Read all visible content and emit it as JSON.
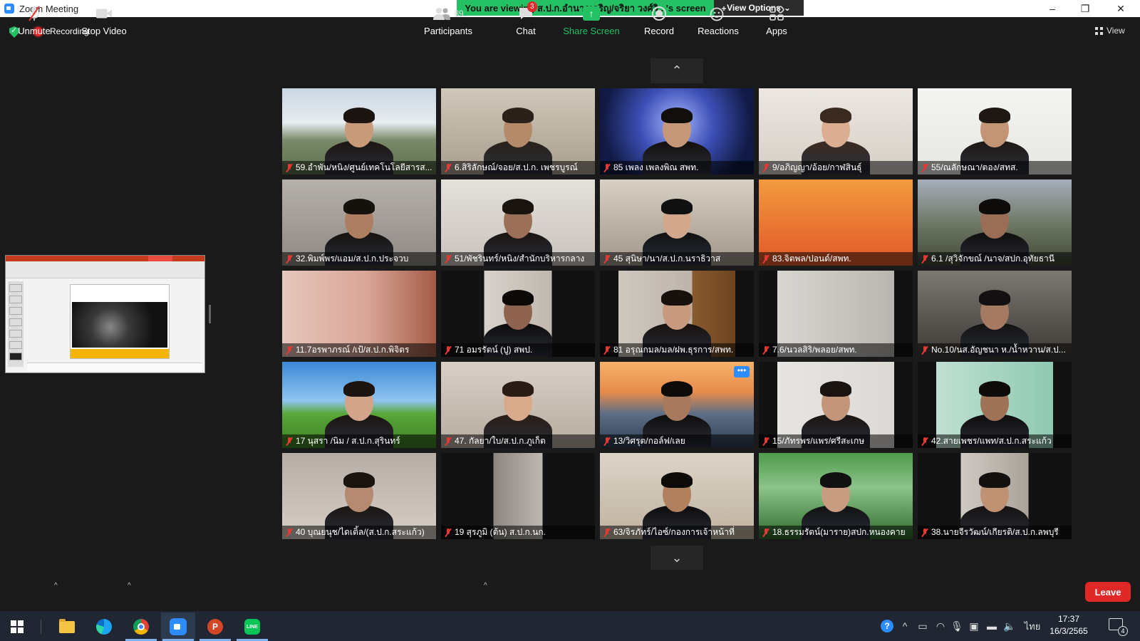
{
  "window": {
    "title": "Zoom Meeting",
    "share_banner": "You are viewing ส.ป.ก.อำนาจเจริญ/จริยา วงศ์วิ...'s screen",
    "view_options": "View Options",
    "minimize": "–",
    "maximize": "❐",
    "close": "✕"
  },
  "top": {
    "recording_label": "Recording",
    "view_label": "View"
  },
  "paging": {
    "up": "⌃",
    "down": "⌄"
  },
  "colors": {
    "accent_green": "#23c064",
    "record_red": "#e02828",
    "zoom_blue": "#2d8cff",
    "muted_red": "#e53935",
    "meeting_bg": "#1a1a1a",
    "taskbar_bg": "#202733"
  },
  "participants": [
    {
      "name": "59.อำพัน/หนิง/ศูนย์เทคโนโลยีสารส...",
      "bg": "linear-gradient(#c9d6e3 0%, #e6ecf0 40%, #7a8a6a 60%, #5b6f4a 100%)",
      "skin": "#c99a7a",
      "hair": "#1b1410"
    },
    {
      "name": "6.สิริลักษณ์/จอย/ส.ป.ก. เพชรบูรณ์",
      "bg": "linear-gradient(#cfc7b8, #a89f90)",
      "skin": "#b58a6a",
      "hair": "#2a211a"
    },
    {
      "name": "85 เพลง เพลงพิณ สพท.",
      "bg": "radial-gradient(circle at 50% 40%, #a7b7ff 0, #3c4fb5 40%, #111a44 80%)",
      "skin": "#c5987a",
      "hair": "#120e0c"
    },
    {
      "name": "9/อภิญญา/อ้อย/กาฬสินธุ์",
      "bg": "linear-gradient(#ece7e1, #d6cec6)",
      "skin": "#dbae92",
      "hair": "#3b2a20"
    },
    {
      "name": "55/ณลักษณา/ตอง/สทส.",
      "bg": "linear-gradient(#f4f4f2, #e6e6e2)",
      "skin": "#c49476",
      "hair": "#1e1712"
    },
    {
      "name": "32.พิมพ์พร/แอม/ส.ป.ก.ประจวบ",
      "bg": "linear-gradient(#b5b0aa, #8f8983)",
      "skin": "#ad7e62",
      "hair": "#15110d"
    },
    {
      "name": "51/พัชรินทร์/หนิง/สำนักบริหารกลาง",
      "bg": "linear-gradient(#e4e0da, #c9c3bc)",
      "skin": "#9c7058",
      "hair": "#1a1410"
    },
    {
      "name": "45 สุนิษา/นา/ส.ป.ก.นราธิวาส",
      "bg": "linear-gradient(#d8d0c4, #a0968a)",
      "skin": "#d2a88d",
      "hair": "#101010"
    },
    {
      "name": "83.จิตพล/ปอนด์/สพท.",
      "bg": "linear-gradient(#f29a3d, #e2572a)",
      "skin": "none",
      "hair": "none"
    },
    {
      "name": "6.1 /สุวิจักขณ์ /นาจ/สปก.อุทัยธานี",
      "bg": "linear-gradient(#a6aebb 0%, #6b7461 55%, #3f4636 100%)",
      "skin": "#9a6e56",
      "hair": "#0e0c0b"
    },
    {
      "name": "11.7อรพาภรณ์ /เป้/ส.ป.ก.พิจิตร",
      "bg": "linear-gradient(90deg, #e7c7bd 0%, #d9a596 55%, #a45b46 100%)",
      "skin": "none",
      "hair": "none"
    },
    {
      "name": "71 อมรรัตน์ (ปู) สพป.",
      "bg": "linear-gradient(90deg, #121212 0%, #121212 28%, #d7d2cb 28%, #bfb8ae 72%, #121212 72%)",
      "skin": "#8e6450",
      "hair": "#0c0a09"
    },
    {
      "name": "81 อรุณกมล/มล/ฝพ.ธุรการ/สพท.",
      "bg": "linear-gradient(90deg, #121212 0%, #121212 12%, #cfc8bf 12%, #bdb4aa 60%, #8a5a2f 60%, #6c441f 88%, #121212 88%)",
      "skin": "#c7997d",
      "hair": "#17110d"
    },
    {
      "name": "7.6/นวลสิริ/พลอย/สพท.",
      "bg": "linear-gradient(90deg, #121212 0%, #121212 12%, #d9d6d2 12%, #b9b5b0 88%, #121212 88%)",
      "skin": "none",
      "hair": "none"
    },
    {
      "name": "No.10/นส.อัญชนา ห./น้ำหวาน/ส.ป...",
      "bg": "linear-gradient(#7c7872, #3d3a36)",
      "skin": "#a47b62",
      "hair": "#121010"
    },
    {
      "name": "17 นุสรา /นิม / ส.ป.ก.สุรินทร์",
      "bg": "linear-gradient(#3a87d6 0%, #8fc5f0 45%, #5aa83a 60%, #3c7f22 100%)",
      "skin": "#d2a58a",
      "hair": "#1b1410"
    },
    {
      "name": "47. กัลยา/ใบ/ส.ป.ก.ภูเก็ต",
      "bg": "linear-gradient(#d8cfc6, #b6aba0)",
      "skin": "#d9a98c",
      "hair": "#2a1c14"
    },
    {
      "name": "13/วิศรุต/กอล์ฟ/เลย",
      "bg": "linear-gradient(#f6b16a 0%, #e88b4b 35%, #5d6e86 60%, #2f3d52 100%)",
      "skin": "#a77a5e",
      "hair": "#0e0c0b"
    },
    {
      "name": "15/ภัทรพร/แพร/ศรีสะเกษ",
      "bg": "linear-gradient(90deg, #121212 0%, #121212 12%, #e7e5e2 12%, #dcd9d5 88%, #121212 88%)",
      "skin": "#c39679",
      "hair": "#1a1410"
    },
    {
      "name": "42.สายเพชร/แพท/ส.ป.ก.สระแก้ว",
      "bg": "linear-gradient(90deg, #121212 0%, #121212 12%, #bfe0d2 12%, #8fc9b2 88%, #121212 88%)",
      "skin": "#9f7358",
      "hair": "#0e0c0b"
    },
    {
      "name": "40 บุณยนุช/ไดเติ้ล/(ส.ป.ก.สระแก้ว)",
      "bg": "linear-gradient(#b6aea6, #d6cec6)",
      "skin": "#b48a70",
      "hair": "#1a1410"
    },
    {
      "name": "19 สุรภูมิ (ต้น) ส.ป.ก.นก.",
      "bg": "linear-gradient(90deg, #121212 0%, #121212 34%, #8b8681 34%, #bdb7b0 66%, #121212 66%)",
      "skin": "none",
      "hair": "none"
    },
    {
      "name": "63/จิรภัทร์/ไอซ์/กองการเจ้าหน้าที่",
      "bg": "linear-gradient(#dcd4c8, #bfb29f)",
      "skin": "#b0805f",
      "hair": "#0d0b0a"
    },
    {
      "name": "18.ธรรมรัตน์(มาราย)สปก.หนองคาย",
      "bg": "linear-gradient(#4e9a4b 0%, #8cc48a 40%, #2e6a2c 100%)",
      "skin": "#c79c80",
      "hair": "#111111"
    },
    {
      "name": "38.นายจีรวัฒน์/เกียรติ/ส.ป.ก.ลพบุรี",
      "bg": "linear-gradient(90deg, #121212 0%, #121212 28%, #cfcac3 28%, #a9a399 72%, #121212 72%)",
      "skin": "#c09274",
      "hair": "#151110"
    }
  ],
  "toolbar": {
    "unmute": "Unmute",
    "stop_video": "Stop Video",
    "participants_label": "Participants",
    "participants_count": "89",
    "chat_label": "Chat",
    "chat_badge": "3",
    "share_screen": "Share Screen",
    "record": "Record",
    "reactions": "Reactions",
    "apps": "Apps",
    "leave": "Leave"
  },
  "taskbar": {
    "language": "ไทย",
    "time": "17:37",
    "date": "16/3/2565",
    "notifications": "4"
  }
}
